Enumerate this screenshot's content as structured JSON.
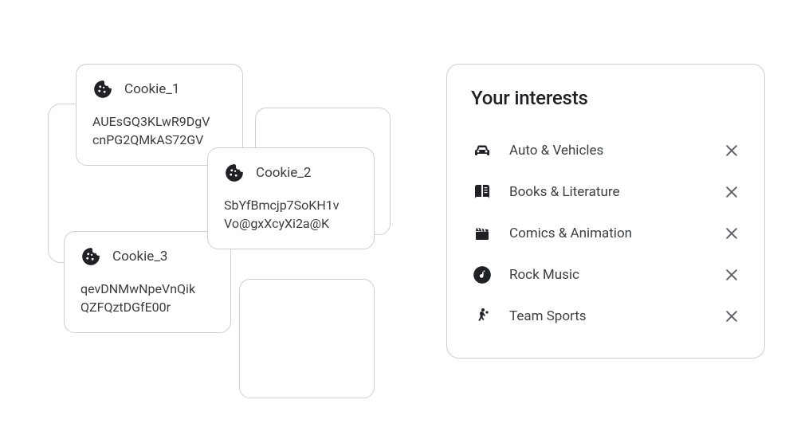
{
  "cookies": [
    {
      "name": "Cookie_1",
      "value_line1": "AUEsGQ3KLwR9DgV",
      "value_line2": "cnPG2QMkAS72GV"
    },
    {
      "name": "Cookie_2",
      "value_line1": "SbYfBmcjp7SoKH1v",
      "value_line2": "Vo@gxXcyXi2a@K"
    },
    {
      "name": "Cookie_3",
      "value_line1": "qevDNMwNpeVnQik",
      "value_line2": "QZFQztDGfE00r"
    }
  ],
  "interests_title": "Your interests",
  "interests": [
    {
      "icon": "car",
      "label": "Auto & Vehicles"
    },
    {
      "icon": "book",
      "label": "Books & Literature"
    },
    {
      "icon": "clapboard",
      "label": "Comics & Animation"
    },
    {
      "icon": "music-note",
      "label": "Rock Music"
    },
    {
      "icon": "handball",
      "label": "Team Sports"
    }
  ]
}
